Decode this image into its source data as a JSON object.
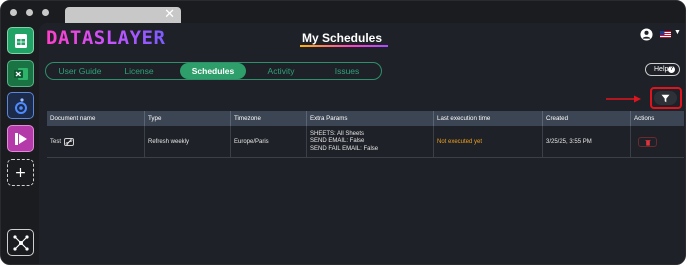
{
  "app": {
    "logo_text": "DATASLAYER",
    "page_title": "My Schedules"
  },
  "tabs": [
    {
      "label": "User Guide",
      "active": false
    },
    {
      "label": "License",
      "active": false
    },
    {
      "label": "Schedules",
      "active": true
    },
    {
      "label": "Activity",
      "active": false
    },
    {
      "label": "Issues",
      "active": false
    }
  ],
  "help": {
    "label": "Help"
  },
  "sidebar": {
    "items": [
      {
        "name": "google-sheets-icon",
        "glyph": "⊞"
      },
      {
        "name": "excel-icon",
        "glyph": "X"
      },
      {
        "name": "looker-studio-icon",
        "glyph": ""
      },
      {
        "name": "power-bi-icon",
        "glyph": ""
      },
      {
        "name": "add-destination-icon",
        "glyph": "+"
      },
      {
        "name": "connections-hub-icon",
        "glyph": ""
      }
    ]
  },
  "table": {
    "headers": [
      "Document name",
      "Type",
      "Timezone",
      "Extra Params",
      "Last execution time",
      "Created",
      "Actions"
    ],
    "rows": [
      {
        "document_name": "Test",
        "type": "Refresh weekly",
        "timezone": "Europe/Paris",
        "extra_params": [
          "SHEETS: All Sheets",
          "SEND EMAIL: False",
          "SEND FAIL EMAIL: False"
        ],
        "last_execution": "Not executed yet",
        "created": "3/25/25, 3:55 PM"
      }
    ]
  },
  "colors": {
    "accent_green": "#2e9e6b",
    "warning_orange": "#f0a020",
    "highlight_red": "#e0141c",
    "header_bg": "#3c4553"
  }
}
